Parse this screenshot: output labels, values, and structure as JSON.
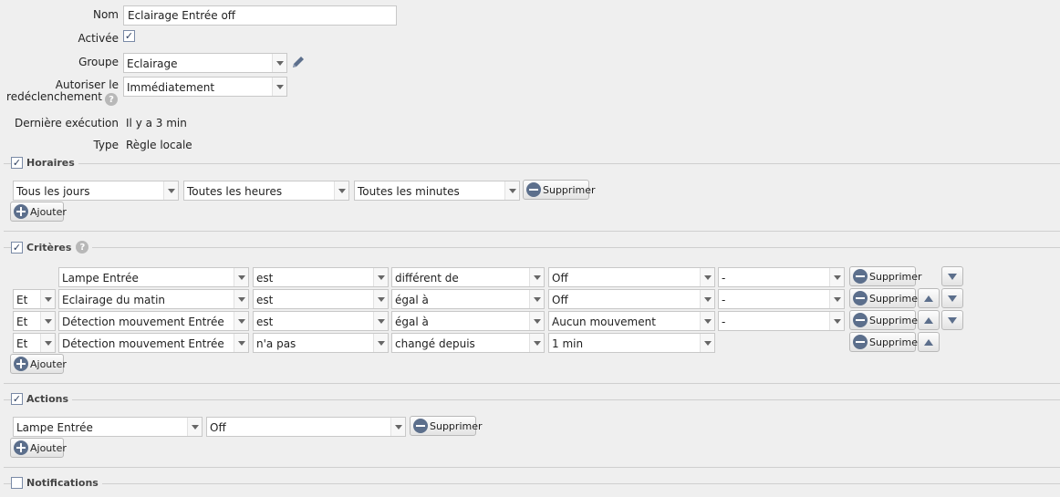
{
  "form": {
    "name_label": "Nom",
    "name_value": "Eclairage Entrée off",
    "enabled_label": "Activée",
    "enabled_checked": true,
    "group_label": "Groupe",
    "group_value": "Eclairage",
    "retrigger_label_line1": "Autoriser le",
    "retrigger_label_line2": "redéclenchement",
    "retrigger_value": "Immédiatement",
    "last_exec_label": "Dernière exécution",
    "last_exec_value": "Il y a 3 min",
    "type_label": "Type",
    "type_value": "Règle locale"
  },
  "common": {
    "delete_label": "Supprimer",
    "add_label": "Ajouter",
    "check_mark": "✓",
    "help_mark": "?"
  },
  "schedule": {
    "title": "Horaires",
    "checked": true,
    "days": "Tous les jours",
    "hours": "Toutes les heures",
    "minutes": "Toutes les minutes"
  },
  "criteria": {
    "title": "Critères",
    "checked": true,
    "rows": [
      {
        "connector": "",
        "device": "Lampe Entrée",
        "verb": "est",
        "operator": "différent de",
        "value": "Off",
        "extra": "-"
      },
      {
        "connector": "Et",
        "device": "Eclairage du matin",
        "verb": "est",
        "operator": "égal à",
        "value": "Off",
        "extra": "-"
      },
      {
        "connector": "Et",
        "device": "Détection mouvement Entrée",
        "verb": "est",
        "operator": "égal à",
        "value": "Aucun mouvement",
        "extra": "-"
      },
      {
        "connector": "Et",
        "device": "Détection mouvement Entrée",
        "verb": "n'a pas",
        "operator": "changé depuis",
        "value": "1 min",
        "extra": ""
      }
    ]
  },
  "actions": {
    "title": "Actions",
    "checked": true,
    "device": "Lampe Entrée",
    "value": "Off"
  },
  "notifications": {
    "title": "Notifications",
    "checked": false
  },
  "colors": {
    "background": "#efefef",
    "icon_blue": "#5c6f8c"
  }
}
